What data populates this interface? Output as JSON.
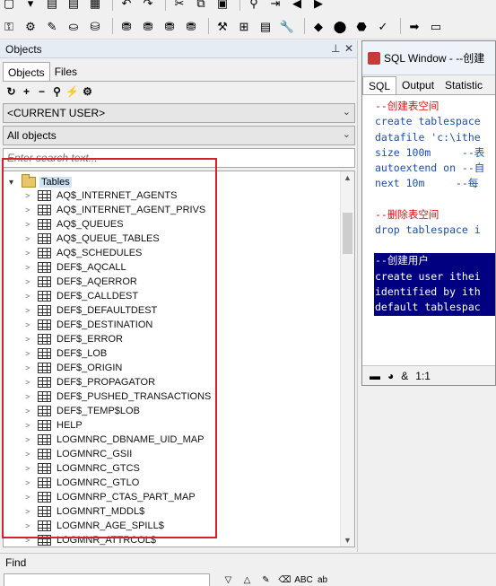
{
  "panels": {
    "objects_title": "Objects",
    "tabs": [
      "Objects",
      "Files"
    ]
  },
  "filters": {
    "user_combo": "<CURRENT USER>",
    "objects_combo": "All objects",
    "search_placeholder": "Enter search text..."
  },
  "tree": {
    "root": "Tables",
    "items": [
      "AQ$_INTERNET_AGENTS",
      "AQ$_INTERNET_AGENT_PRIVS",
      "AQ$_QUEUES",
      "AQ$_QUEUE_TABLES",
      "AQ$_SCHEDULES",
      "DEF$_AQCALL",
      "DEF$_AQERROR",
      "DEF$_CALLDEST",
      "DEF$_DEFAULTDEST",
      "DEF$_DESTINATION",
      "DEF$_ERROR",
      "DEF$_LOB",
      "DEF$_ORIGIN",
      "DEF$_PROPAGATOR",
      "DEF$_PUSHED_TRANSACTIONS",
      "DEF$_TEMP$LOB",
      "HELP",
      "LOGMNRC_DBNAME_UID_MAP",
      "LOGMNRC_GSII",
      "LOGMNRC_GTCS",
      "LOGMNRC_GTLO",
      "LOGMNRP_CTAS_PART_MAP",
      "LOGMNRT_MDDL$",
      "LOGMNR_AGE_SPILL$",
      "LOGMNR_ATTRCOL$"
    ]
  },
  "sql_window": {
    "title": "SQL Window - --创建",
    "tabs": [
      "SQL",
      "Output",
      "Statistic"
    ],
    "lines": [
      "--创建表空间",
      "create tablespace",
      "datafile 'c:\\ithe",
      "size 100m     --表",
      "autoextend on --自",
      "next 10m     --每",
      "",
      "--删除表空间",
      "drop tablespace i",
      "",
      "--创建用户",
      "create user ithei",
      "identified by ith",
      "default tablespac"
    ],
    "cursor_position": "1:1"
  },
  "find": {
    "label": "Find"
  },
  "colors": {
    "selection": "#000080",
    "comment": "#dd1111",
    "keyword": "#1a4fb0",
    "annotation_box": "#d6202a"
  }
}
